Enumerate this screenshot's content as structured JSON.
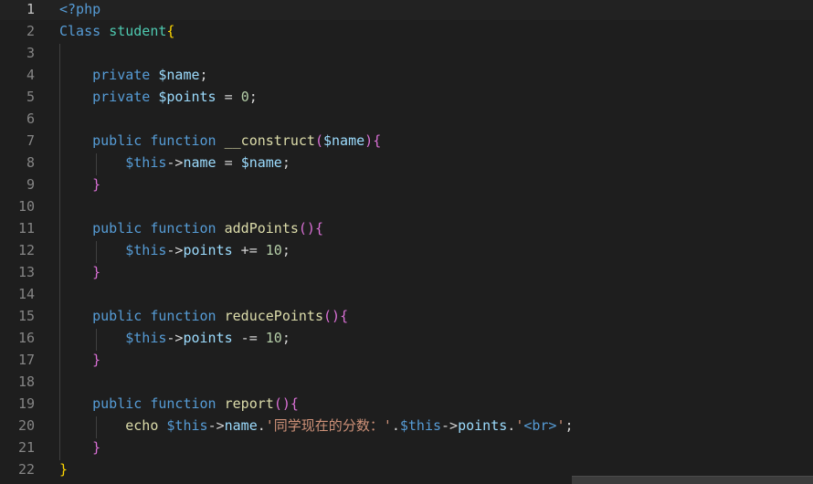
{
  "editor": {
    "language": "php",
    "current_line": 1,
    "lines": [
      {
        "num": "1",
        "tokens": [
          {
            "c": "t-kw",
            "t": "<?php"
          }
        ]
      },
      {
        "num": "2",
        "tokens": [
          {
            "c": "t-kw",
            "t": "Class"
          },
          {
            "c": "t-txt",
            "t": " "
          },
          {
            "c": "t-cls",
            "t": "student"
          },
          {
            "c": "t-br1",
            "t": "{"
          }
        ]
      },
      {
        "num": "3",
        "tokens": []
      },
      {
        "num": "4",
        "tokens": [
          {
            "c": "t-txt",
            "t": "    "
          },
          {
            "c": "t-kw",
            "t": "private"
          },
          {
            "c": "t-txt",
            "t": " "
          },
          {
            "c": "t-var",
            "t": "$name"
          },
          {
            "c": "t-txt",
            "t": ";"
          }
        ]
      },
      {
        "num": "5",
        "tokens": [
          {
            "c": "t-txt",
            "t": "    "
          },
          {
            "c": "t-kw",
            "t": "private"
          },
          {
            "c": "t-txt",
            "t": " "
          },
          {
            "c": "t-var",
            "t": "$points"
          },
          {
            "c": "t-txt",
            "t": " = "
          },
          {
            "c": "t-num",
            "t": "0"
          },
          {
            "c": "t-txt",
            "t": ";"
          }
        ]
      },
      {
        "num": "6",
        "tokens": []
      },
      {
        "num": "7",
        "tokens": [
          {
            "c": "t-txt",
            "t": "    "
          },
          {
            "c": "t-kw",
            "t": "public"
          },
          {
            "c": "t-txt",
            "t": " "
          },
          {
            "c": "t-kw",
            "t": "function"
          },
          {
            "c": "t-txt",
            "t": " "
          },
          {
            "c": "t-fn",
            "t": "__construct"
          },
          {
            "c": "t-br2",
            "t": "("
          },
          {
            "c": "t-var",
            "t": "$name"
          },
          {
            "c": "t-br2",
            "t": ")"
          },
          {
            "c": "t-br2",
            "t": "{"
          }
        ]
      },
      {
        "num": "8",
        "tokens": [
          {
            "c": "t-txt",
            "t": "        "
          },
          {
            "c": "t-this",
            "t": "$this"
          },
          {
            "c": "t-txt",
            "t": "->"
          },
          {
            "c": "t-var",
            "t": "name"
          },
          {
            "c": "t-txt",
            "t": " = "
          },
          {
            "c": "t-var",
            "t": "$name"
          },
          {
            "c": "t-txt",
            "t": ";"
          }
        ]
      },
      {
        "num": "9",
        "tokens": [
          {
            "c": "t-txt",
            "t": "    "
          },
          {
            "c": "t-br2",
            "t": "}"
          }
        ]
      },
      {
        "num": "10",
        "tokens": []
      },
      {
        "num": "11",
        "tokens": [
          {
            "c": "t-txt",
            "t": "    "
          },
          {
            "c": "t-kw",
            "t": "public"
          },
          {
            "c": "t-txt",
            "t": " "
          },
          {
            "c": "t-kw",
            "t": "function"
          },
          {
            "c": "t-txt",
            "t": " "
          },
          {
            "c": "t-fn",
            "t": "addPoints"
          },
          {
            "c": "t-br2",
            "t": "()"
          },
          {
            "c": "t-br2",
            "t": "{"
          }
        ]
      },
      {
        "num": "12",
        "tokens": [
          {
            "c": "t-txt",
            "t": "        "
          },
          {
            "c": "t-this",
            "t": "$this"
          },
          {
            "c": "t-txt",
            "t": "->"
          },
          {
            "c": "t-var",
            "t": "points"
          },
          {
            "c": "t-txt",
            "t": " += "
          },
          {
            "c": "t-num",
            "t": "10"
          },
          {
            "c": "t-txt",
            "t": ";"
          }
        ]
      },
      {
        "num": "13",
        "tokens": [
          {
            "c": "t-txt",
            "t": "    "
          },
          {
            "c": "t-br2",
            "t": "}"
          }
        ]
      },
      {
        "num": "14",
        "tokens": []
      },
      {
        "num": "15",
        "tokens": [
          {
            "c": "t-txt",
            "t": "    "
          },
          {
            "c": "t-kw",
            "t": "public"
          },
          {
            "c": "t-txt",
            "t": " "
          },
          {
            "c": "t-kw",
            "t": "function"
          },
          {
            "c": "t-txt",
            "t": " "
          },
          {
            "c": "t-fn",
            "t": "reducePoints"
          },
          {
            "c": "t-br2",
            "t": "()"
          },
          {
            "c": "t-br2",
            "t": "{"
          }
        ]
      },
      {
        "num": "16",
        "tokens": [
          {
            "c": "t-txt",
            "t": "        "
          },
          {
            "c": "t-this",
            "t": "$this"
          },
          {
            "c": "t-txt",
            "t": "->"
          },
          {
            "c": "t-var",
            "t": "points"
          },
          {
            "c": "t-txt",
            "t": " -= "
          },
          {
            "c": "t-num",
            "t": "10"
          },
          {
            "c": "t-txt",
            "t": ";"
          }
        ]
      },
      {
        "num": "17",
        "tokens": [
          {
            "c": "t-txt",
            "t": "    "
          },
          {
            "c": "t-br2",
            "t": "}"
          }
        ]
      },
      {
        "num": "18",
        "tokens": []
      },
      {
        "num": "19",
        "tokens": [
          {
            "c": "t-txt",
            "t": "    "
          },
          {
            "c": "t-kw",
            "t": "public"
          },
          {
            "c": "t-txt",
            "t": " "
          },
          {
            "c": "t-kw",
            "t": "function"
          },
          {
            "c": "t-txt",
            "t": " "
          },
          {
            "c": "t-fn",
            "t": "report"
          },
          {
            "c": "t-br2",
            "t": "()"
          },
          {
            "c": "t-br2",
            "t": "{"
          }
        ]
      },
      {
        "num": "20",
        "tokens": [
          {
            "c": "t-txt",
            "t": "        "
          },
          {
            "c": "t-fn",
            "t": "echo"
          },
          {
            "c": "t-txt",
            "t": " "
          },
          {
            "c": "t-this",
            "t": "$this"
          },
          {
            "c": "t-txt",
            "t": "->"
          },
          {
            "c": "t-var",
            "t": "name"
          },
          {
            "c": "t-txt",
            "t": "."
          },
          {
            "c": "t-str",
            "t": "'同学现在的分数：'"
          },
          {
            "c": "t-txt",
            "t": "."
          },
          {
            "c": "t-this",
            "t": "$this"
          },
          {
            "c": "t-txt",
            "t": "->"
          },
          {
            "c": "t-var",
            "t": "points"
          },
          {
            "c": "t-txt",
            "t": "."
          },
          {
            "c": "t-str",
            "t": "'"
          },
          {
            "c": "t-tag",
            "t": "<br>"
          },
          {
            "c": "t-str",
            "t": "'"
          },
          {
            "c": "t-txt",
            "t": ";"
          }
        ]
      },
      {
        "num": "21",
        "tokens": [
          {
            "c": "t-txt",
            "t": "    "
          },
          {
            "c": "t-br2",
            "t": "}"
          }
        ]
      },
      {
        "num": "22",
        "tokens": [
          {
            "c": "t-br1",
            "t": "}"
          }
        ]
      }
    ]
  }
}
